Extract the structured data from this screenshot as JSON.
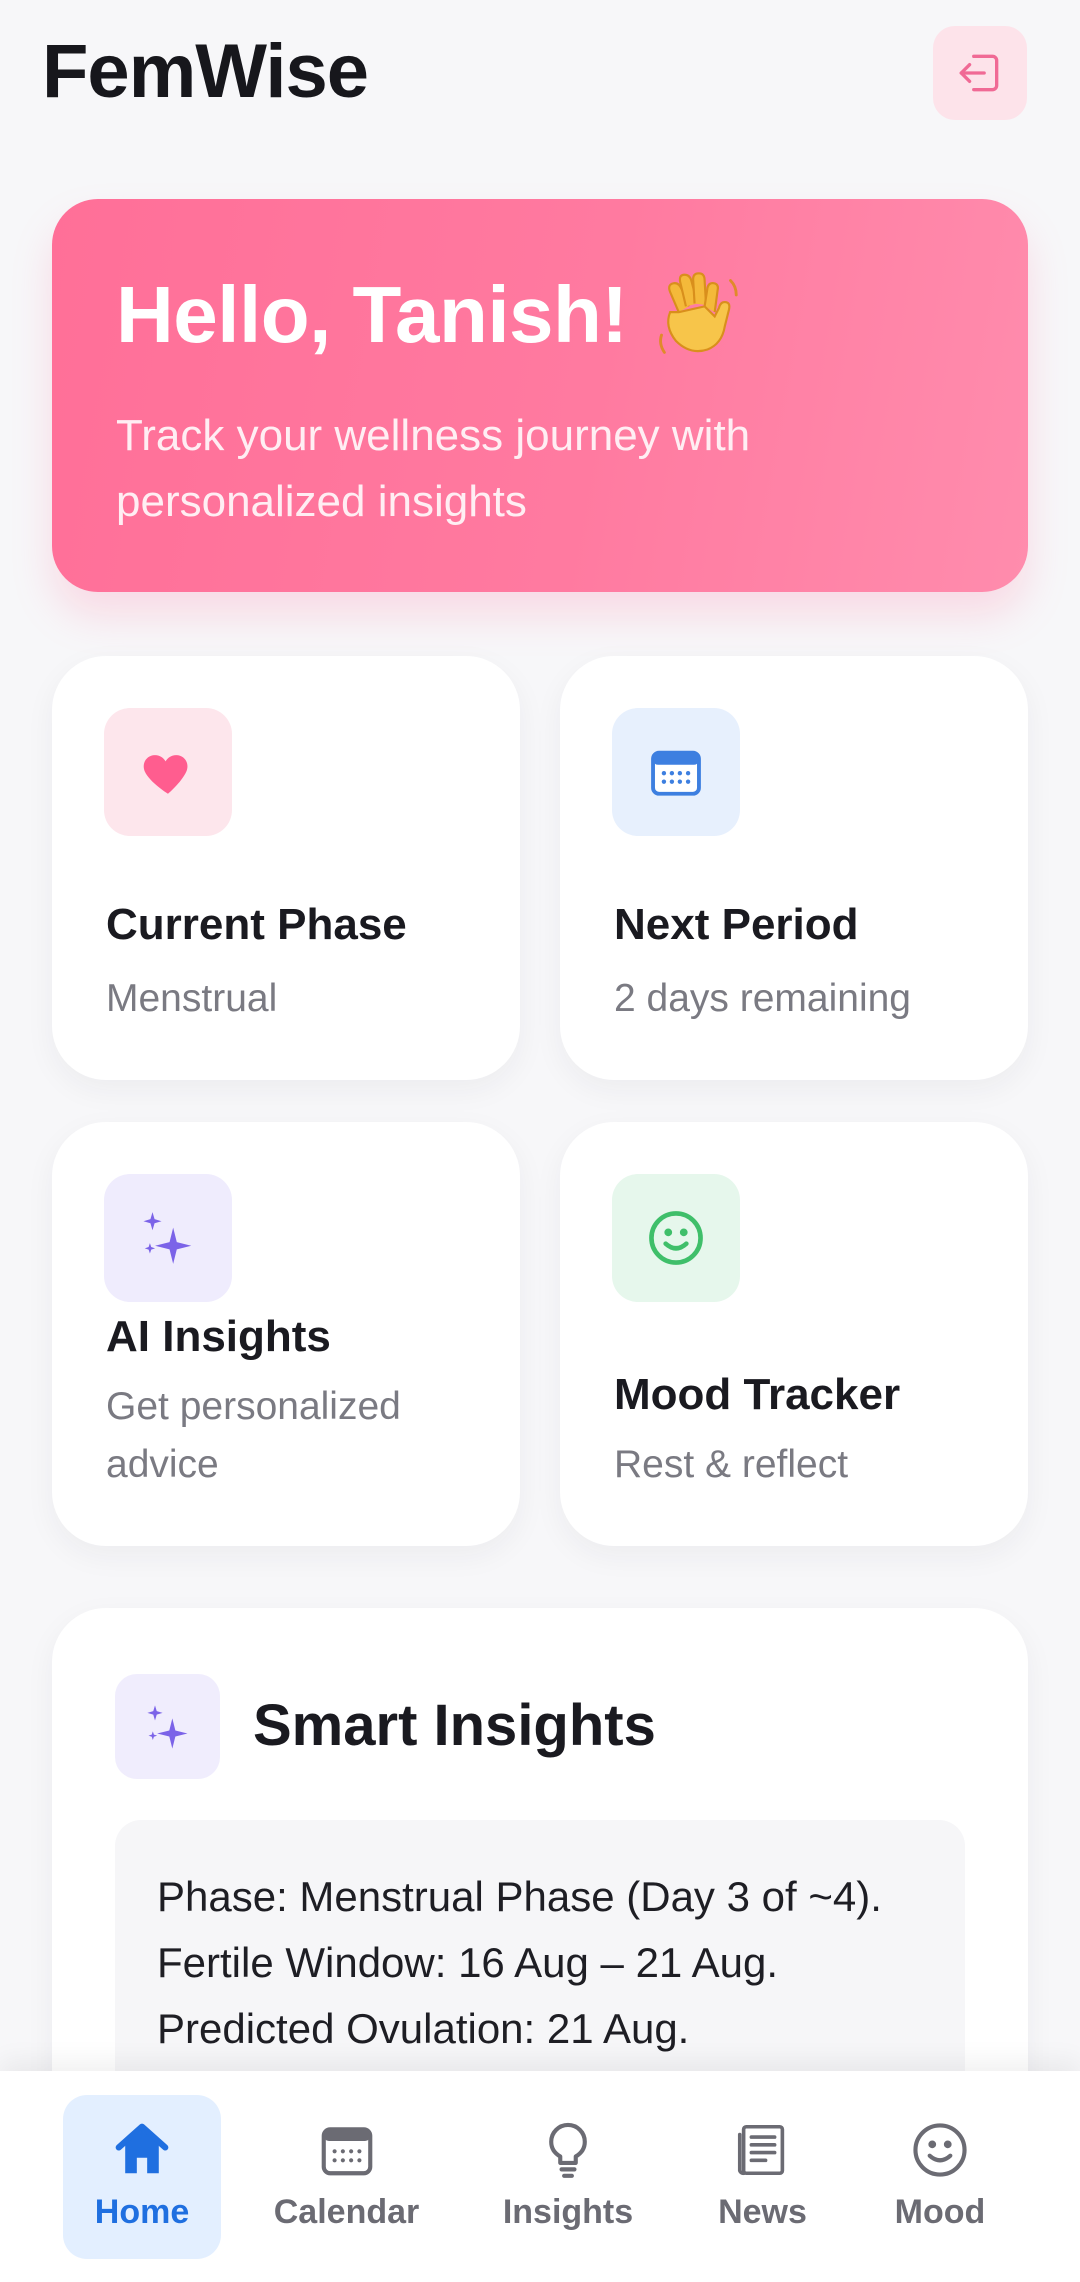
{
  "app": {
    "title": "FemWise"
  },
  "header": {
    "logout_icon": "logout-icon"
  },
  "hero": {
    "greeting": "Hello, Tanish!",
    "subtitle": "Track your wellness journey with personalized insights",
    "icon": "waving-hand-icon"
  },
  "cards": [
    {
      "title": "Current Phase",
      "subtitle": "Menstrual",
      "icon": "heart-icon",
      "icon_color": "#ff5d8f",
      "icon_bg": "#fde6ec"
    },
    {
      "title": "Next Period",
      "subtitle": "2 days remaining",
      "icon": "calendar-icon",
      "icon_color": "#3d7fe0",
      "icon_bg": "#e7f0fd"
    },
    {
      "title": "AI Insights",
      "subtitle": "Get personalized advice",
      "icon": "sparkles-icon",
      "icon_color": "#7b63e8",
      "icon_bg": "#efecfd"
    },
    {
      "title": "Mood Tracker",
      "subtitle": "Rest & reflect",
      "icon": "smile-icon",
      "icon_color": "#3fbf6a",
      "icon_bg": "#e6f7ec"
    }
  ],
  "smart_insights": {
    "title": "Smart Insights",
    "lines": [
      "Phase: Menstrual Phase (Day 3 of ~4).",
      "Fertile Window: 16 Aug – 21 Aug.",
      "Predicted Ovulation: 21 Aug."
    ]
  },
  "nav": {
    "items": [
      {
        "label": "Home",
        "icon": "home-icon",
        "active": true
      },
      {
        "label": "Calendar",
        "icon": "calendar-icon",
        "active": false
      },
      {
        "label": "Insights",
        "icon": "lightbulb-icon",
        "active": false
      },
      {
        "label": "News",
        "icon": "news-icon",
        "active": false
      },
      {
        "label": "Mood",
        "icon": "smile-icon",
        "active": false
      }
    ]
  },
  "colors": {
    "accent_pink": "#ff6f98",
    "nav_active": "#1f6fe0",
    "nav_active_bg": "#e3efff"
  }
}
